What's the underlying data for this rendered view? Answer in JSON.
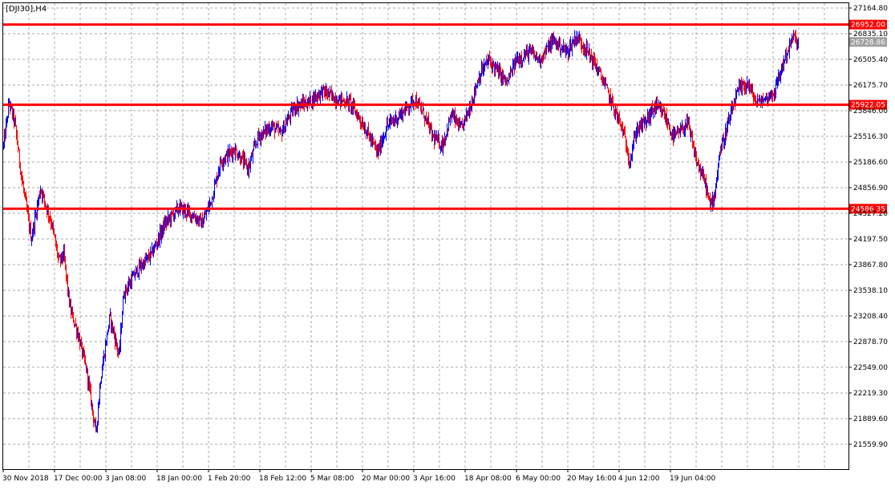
{
  "chart_data": {
    "type": "candlestick",
    "title": "[DJI30],H4",
    "ylim": [
      21400,
      27300
    ],
    "grid": true,
    "colors": {
      "up": "#0000ff",
      "down": "#ff0000",
      "grid": "#a8a8a8",
      "level": "#ff0000",
      "current_label_bg": "#a0a0a0",
      "axis": "#000000"
    },
    "y_ticks": [
      "27164.80",
      "26835.10",
      "26505.40",
      "26175.70",
      "25846.00",
      "25516.30",
      "25186.60",
      "24856.90",
      "24527.20",
      "24197.50",
      "23867.80",
      "23538.10",
      "23208.40",
      "22878.70",
      "22549.00",
      "22219.30",
      "21889.60",
      "21559.90"
    ],
    "x_ticks": [
      "30 Nov 2018",
      "17 Dec 00:00",
      "3 Jan 08:00",
      "18 Jan 00:00",
      "1 Feb 20:00",
      "18 Feb 12:00",
      "5 Mar 08:00",
      "20 Mar 00:00",
      "3 Apr 16:00",
      "18 Apr 08:00",
      "6 May 00:00",
      "20 May 16:00",
      "4 Jun 12:00",
      "19 Jun 04:00"
    ],
    "levels": [
      {
        "value": 26952.0,
        "label": "26952.00"
      },
      {
        "value": 25922.05,
        "label": "25922.05"
      },
      {
        "value": 24586.35,
        "label": "24586.35"
      }
    ],
    "current_price": {
      "value": 26728.86,
      "label": "26728.86"
    },
    "price_path": [
      [
        0,
        25400
      ],
      [
        0.6,
        25950
      ],
      [
        1.2,
        25700
      ],
      [
        2.0,
        24950
      ],
      [
        3.0,
        24200
      ],
      [
        4.0,
        24850
      ],
      [
        5.2,
        24400
      ],
      [
        6.0,
        23900
      ],
      [
        6.5,
        24000
      ],
      [
        7.2,
        23300
      ],
      [
        8.0,
        23000
      ],
      [
        9.0,
        22500
      ],
      [
        10.0,
        21700
      ],
      [
        10.5,
        22400
      ],
      [
        11.5,
        23200
      ],
      [
        12.5,
        22700
      ],
      [
        13.0,
        23500
      ],
      [
        14.5,
        23800
      ],
      [
        16.0,
        24000
      ],
      [
        17.5,
        24400
      ],
      [
        19.0,
        24600
      ],
      [
        20.5,
        24500
      ],
      [
        21.5,
        24400
      ],
      [
        22.5,
        24700
      ],
      [
        23.5,
        25200
      ],
      [
        25.0,
        25350
      ],
      [
        26.5,
        25100
      ],
      [
        27.5,
        25500
      ],
      [
        29.0,
        25650
      ],
      [
        30.0,
        25550
      ],
      [
        31.5,
        25900
      ],
      [
        33.0,
        25950
      ],
      [
        34.5,
        26100
      ],
      [
        36.0,
        26000
      ],
      [
        37.5,
        25950
      ],
      [
        39.0,
        25650
      ],
      [
        40.5,
        25300
      ],
      [
        41.5,
        25650
      ],
      [
        43.0,
        25800
      ],
      [
        44.5,
        26000
      ],
      [
        45.5,
        25800
      ],
      [
        46.5,
        25500
      ],
      [
        47.5,
        25400
      ],
      [
        48.5,
        25800
      ],
      [
        49.5,
        25600
      ],
      [
        50.5,
        25900
      ],
      [
        51.5,
        26300
      ],
      [
        52.5,
        26500
      ],
      [
        53.5,
        26350
      ],
      [
        54.5,
        26200
      ],
      [
        55.5,
        26500
      ],
      [
        57.0,
        26600
      ],
      [
        58.0,
        26500
      ],
      [
        59.5,
        26750
      ],
      [
        61.0,
        26600
      ],
      [
        62.0,
        26800
      ],
      [
        63.0,
        26650
      ],
      [
        64.0,
        26450
      ],
      [
        65.0,
        26200
      ],
      [
        66.0,
        25900
      ],
      [
        67.0,
        25600
      ],
      [
        67.8,
        25200
      ],
      [
        68.5,
        25600
      ],
      [
        69.5,
        25700
      ],
      [
        70.5,
        25900
      ],
      [
        71.5,
        25800
      ],
      [
        72.5,
        25500
      ],
      [
        73.5,
        25600
      ],
      [
        74.0,
        25700
      ],
      [
        75.0,
        25200
      ],
      [
        76.0,
        24900
      ],
      [
        76.5,
        24600
      ],
      [
        77.0,
        24800
      ],
      [
        77.5,
        25300
      ],
      [
        78.5,
        25700
      ],
      [
        79.5,
        26100
      ],
      [
        80.5,
        26200
      ],
      [
        81.5,
        25950
      ],
      [
        82.5,
        26000
      ],
      [
        83.5,
        26100
      ],
      [
        84.5,
        26500
      ],
      [
        85.5,
        26800
      ],
      [
        86.0,
        26700
      ]
    ],
    "pos_min": 0,
    "pos_max": 91.5
  }
}
